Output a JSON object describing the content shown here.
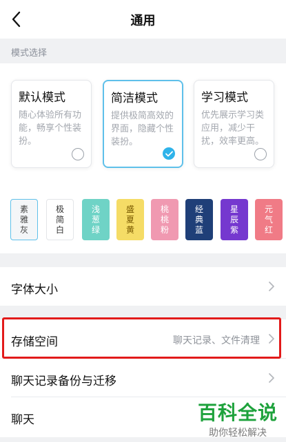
{
  "header": {
    "title": "通用",
    "back_icon": "chevron-left-icon"
  },
  "mode_section": {
    "label": "模式选择",
    "modes": [
      {
        "title": "默认模式",
        "desc": "随心体验所有功能，畅享个性装扮。",
        "selected": false
      },
      {
        "title": "简洁模式",
        "desc": "提供极简高效的界面，隐藏个性装扮。",
        "selected": true
      },
      {
        "title": "学习模式",
        "desc": "优先展示学习类应用，减少干扰，效率更高。",
        "selected": false
      }
    ]
  },
  "themes": [
    {
      "name": "素雅灰",
      "bg": "#f4f6f8",
      "fg": "#444444",
      "selected": true
    },
    {
      "name": "极简白",
      "bg": "#ffffff",
      "fg": "#333333",
      "selected": false
    },
    {
      "name": "浅葱绿",
      "bg": "#6fd3c6",
      "fg": "#ffffff",
      "selected": false
    },
    {
      "name": "盛夏黄",
      "bg": "#f5dc66",
      "fg": "#7a5a00",
      "selected": false
    },
    {
      "name": "桃桃粉",
      "bg": "#f099b1",
      "fg": "#ffffff",
      "selected": false
    },
    {
      "name": "经典蓝",
      "bg": "#1f3f78",
      "fg": "#ffffff",
      "selected": false
    },
    {
      "name": "星辰紫",
      "bg": "#7538cf",
      "fg": "#ffffff",
      "selected": false
    },
    {
      "name": "元气红",
      "bg": "#f07b86",
      "fg": "#ffffff",
      "selected": false
    }
  ],
  "settings": {
    "font_size": {
      "label": "字体大小"
    },
    "storage": {
      "label": "存储空间",
      "value": "聊天记录、文件清理"
    },
    "backup": {
      "label": "聊天记录备份与迁移"
    },
    "chat": {
      "label": "聊天"
    }
  },
  "watermark": {
    "title": "百科全说",
    "subtitle": "助你轻松解决"
  },
  "colors": {
    "accent": "#2fb3ea",
    "highlight": "#e21a1a",
    "watermark": "#1ea23c"
  }
}
